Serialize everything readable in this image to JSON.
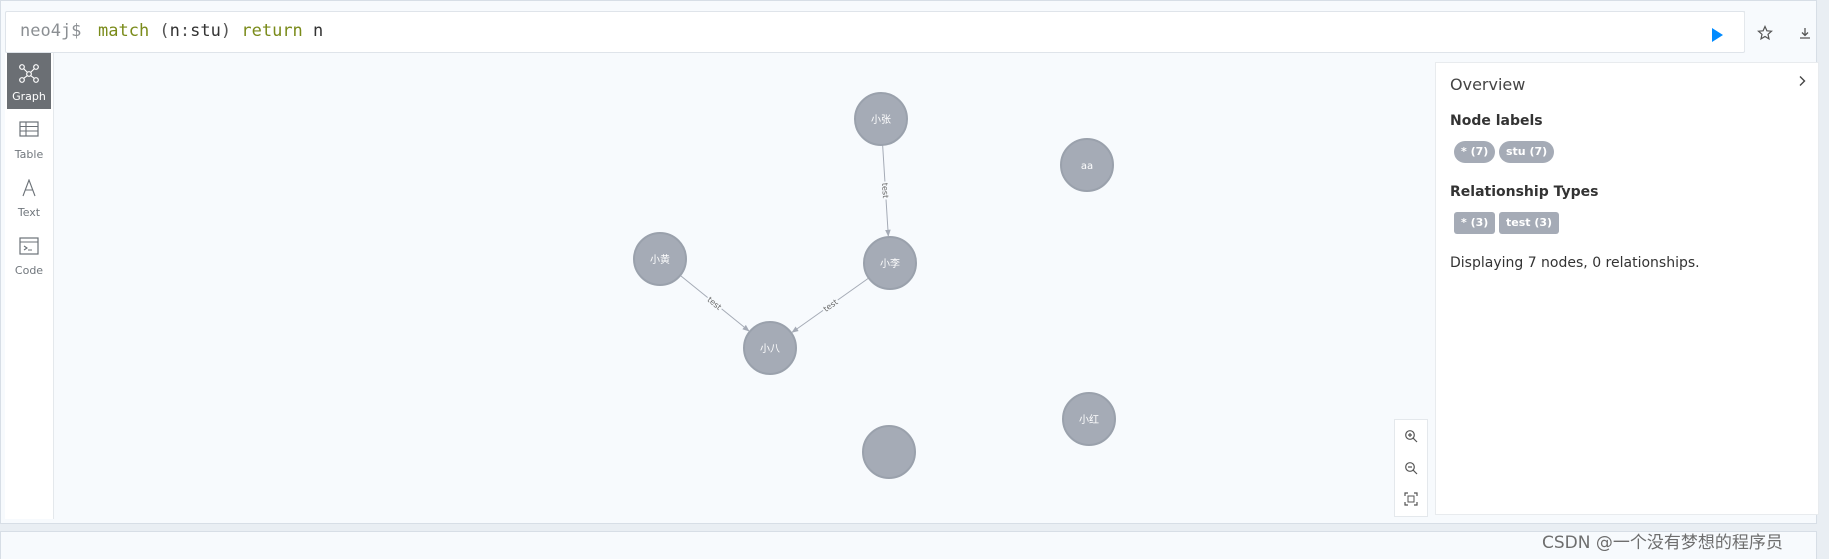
{
  "editor": {
    "prompt": "neo4j$",
    "query_tokens": [
      {
        "text": "match",
        "kind": "kw"
      },
      {
        "text": " (",
        "kind": "p"
      },
      {
        "text": "n",
        "kind": "v"
      },
      {
        "text": ":",
        "kind": "p"
      },
      {
        "text": "stu",
        "kind": "lbl"
      },
      {
        "text": ") ",
        "kind": "p"
      },
      {
        "text": "return",
        "kind": "kw"
      },
      {
        "text": " n",
        "kind": "v"
      }
    ],
    "run_icon": "play-icon",
    "favorite_icon": "star-icon",
    "download_icon": "download-icon",
    "accent_color": "#018bff"
  },
  "views": [
    {
      "label": "Graph",
      "icon": "graph-icon",
      "active": true
    },
    {
      "label": "Table",
      "icon": "table-icon",
      "active": false
    },
    {
      "label": "Text",
      "icon": "text-icon",
      "active": false
    },
    {
      "label": "Code",
      "icon": "code-icon",
      "active": false
    }
  ],
  "graph": {
    "node_color": "#a5abb6",
    "nodes": [
      {
        "id": "n1",
        "label": "小张"
      },
      {
        "id": "n2",
        "label": "小李"
      },
      {
        "id": "n3",
        "label": "小黄"
      },
      {
        "id": "n4",
        "label": "小八"
      },
      {
        "id": "n5",
        "label": "aa"
      },
      {
        "id": "n6",
        "label": "小红"
      },
      {
        "id": "n7",
        "label": ""
      }
    ],
    "relationships": [
      {
        "from": "n1",
        "to": "n2",
        "type": "test"
      },
      {
        "from": "n3",
        "to": "n4",
        "type": "test"
      },
      {
        "from": "n2",
        "to": "n4",
        "type": "test"
      }
    ]
  },
  "zoom": {
    "zoom_in_icon": "zoom-in-icon",
    "zoom_out_icon": "zoom-out-icon",
    "fit_icon": "fit-screen-icon"
  },
  "overview": {
    "title": "Overview",
    "node_labels_heading": "Node labels",
    "node_labels": [
      "* (7)",
      "stu (7)"
    ],
    "relationship_types_heading": "Relationship Types",
    "relationship_types": [
      "* (3)",
      "test (3)"
    ],
    "summary": "Displaying 7 nodes, 0 relationships."
  },
  "watermark": "CSDN @一个没有梦想的程序员"
}
